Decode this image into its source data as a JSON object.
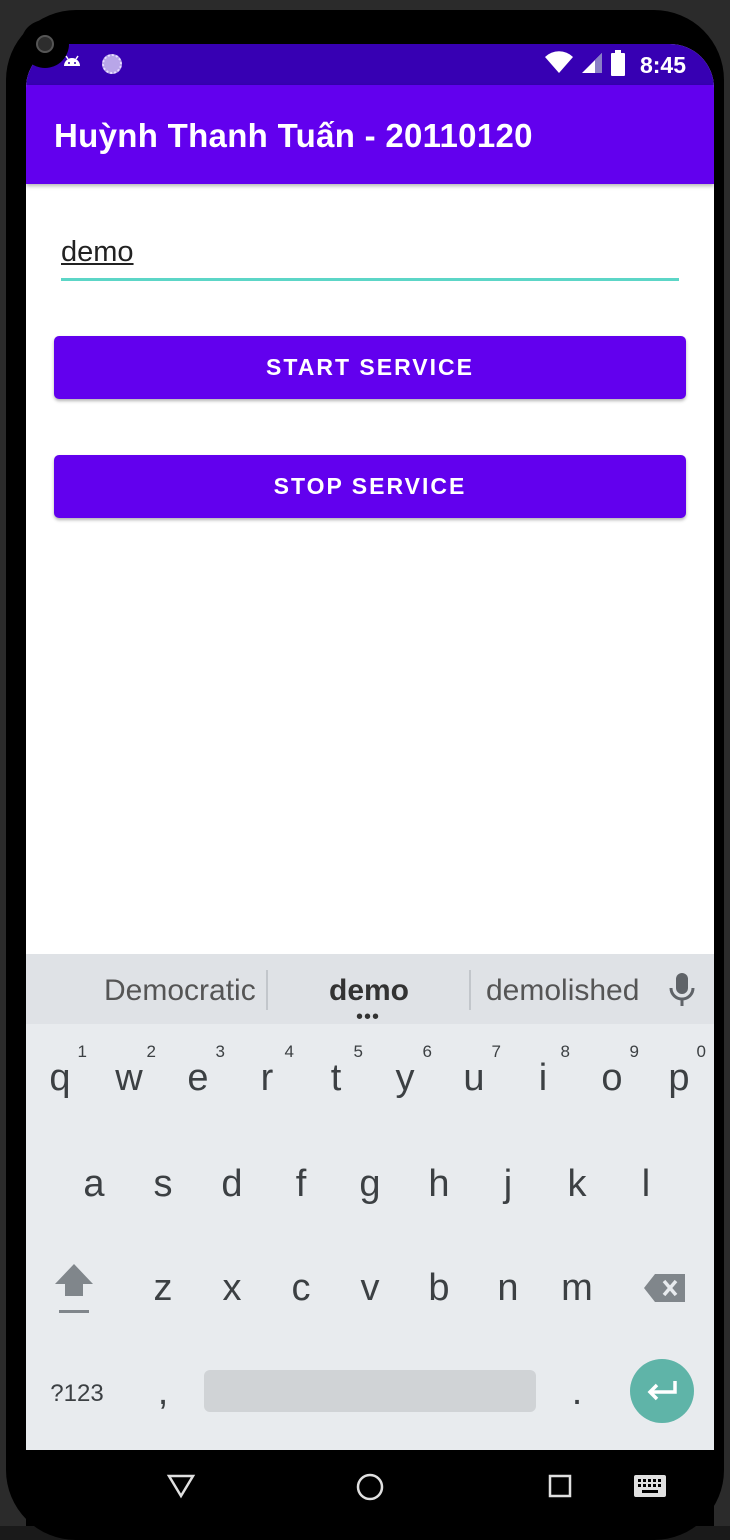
{
  "status_bar": {
    "time": "8:45"
  },
  "app_bar": {
    "title": "Huỳnh Thanh Tuấn - 20110120"
  },
  "form": {
    "input_value": "demo",
    "start_button": "START SERVICE",
    "stop_button": "STOP SERVICE"
  },
  "keyboard": {
    "suggestions": [
      "Democratic",
      "demo",
      "demolished"
    ],
    "row1": [
      {
        "key": "q",
        "num": "1"
      },
      {
        "key": "w",
        "num": "2"
      },
      {
        "key": "e",
        "num": "3"
      },
      {
        "key": "r",
        "num": "4"
      },
      {
        "key": "t",
        "num": "5"
      },
      {
        "key": "y",
        "num": "6"
      },
      {
        "key": "u",
        "num": "7"
      },
      {
        "key": "i",
        "num": "8"
      },
      {
        "key": "o",
        "num": "9"
      },
      {
        "key": "p",
        "num": "0"
      }
    ],
    "row2": [
      "a",
      "s",
      "d",
      "f",
      "g",
      "h",
      "j",
      "k",
      "l"
    ],
    "row3": [
      "z",
      "x",
      "c",
      "v",
      "b",
      "n",
      "m"
    ],
    "symbols_key": "?123",
    "comma_key": ",",
    "period_key": "."
  },
  "colors": {
    "primary": "#6200ee",
    "primary_dark": "#3700b3",
    "accent": "#5cd6c7"
  }
}
